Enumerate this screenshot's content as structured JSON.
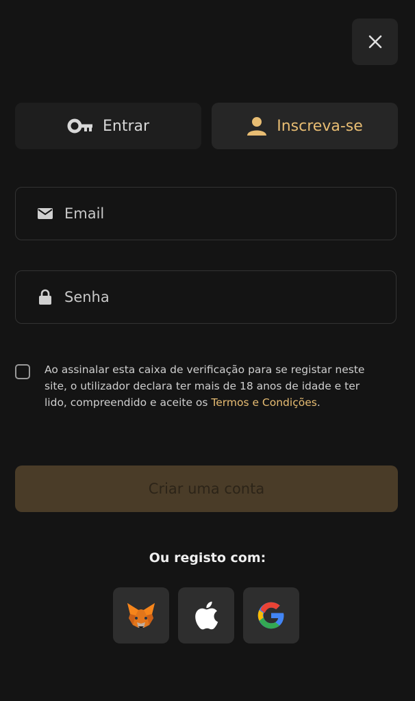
{
  "tabs": [
    {
      "label": "Entrar",
      "icon": "key-icon",
      "active": false
    },
    {
      "label": "Inscreva-se",
      "icon": "user-icon",
      "active": true
    }
  ],
  "form": {
    "email_placeholder": "Email",
    "email_value": "",
    "password_placeholder": "Senha",
    "password_value": ""
  },
  "terms": {
    "checked": false,
    "text": "Ao assinalar esta caixa de verificação para se registar neste site, o utilizador declara ter mais de 18 anos de idade e ter lido, compreendido e aceite os ",
    "link": "Termos e Condições",
    "suffix": "."
  },
  "create_button": {
    "label": "Criar uma conta",
    "disabled": true
  },
  "social": {
    "label": "Ou registo com:",
    "providers": [
      "metamask-icon",
      "apple-icon",
      "google-icon"
    ]
  },
  "colors": {
    "accent": "#e8bd73",
    "background": "#141414",
    "tab_inactive": "#1e1e1e",
    "tab_active": "#262626",
    "button_disabled": "#4a3c28"
  }
}
